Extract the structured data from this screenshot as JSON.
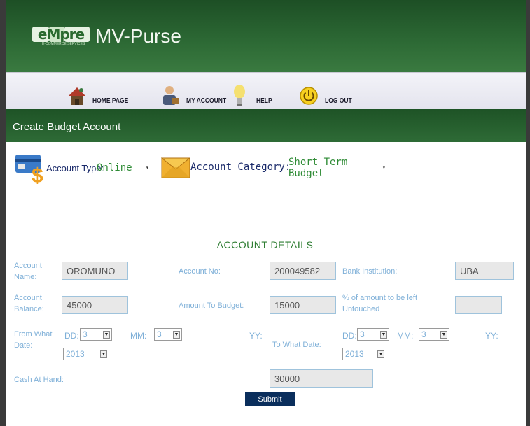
{
  "header": {
    "logo_text": "eMpre",
    "logo_sub": "E-COMMERCE SERVICES",
    "app_title": "MV-Purse"
  },
  "nav": {
    "items": [
      {
        "label": "HOME PAGE",
        "icon": "home-icon"
      },
      {
        "label": "MY ACCOUNT",
        "icon": "account-user-icon"
      },
      {
        "label": "HELP",
        "icon": "lightbulb-icon"
      },
      {
        "label": "LOG OUT",
        "icon": "power-icon"
      }
    ]
  },
  "section": {
    "title": "Create Budget Account"
  },
  "account_type": {
    "label": "Account Type:",
    "selected": "Online",
    "icon": "card-money-icon"
  },
  "account_category": {
    "label": "Account Category:",
    "selected": "Short Term Budget",
    "icon": "envelope-icon"
  },
  "details": {
    "title": "ACCOUNT DETAILS",
    "account_name_label": "Account Name:",
    "account_name_value": "OROMUNO",
    "account_no_label": "Account No:",
    "account_no_value": "200049582",
    "bank_label": "Bank Institution:",
    "bank_value": "UBA",
    "balance_label": "Account Balance:",
    "balance_value": "45000",
    "amount_budget_label": "Amount To Budget:",
    "amount_budget_value": "15000",
    "left_untouched_label": "% of amount to be left Untouched",
    "left_untouched_value": "",
    "from_date_label": "From What Date:",
    "to_date_label": "To What Date:",
    "dd_label": "DD:",
    "mm_label": "MM:",
    "yy_label": "YY:",
    "from_dd": "3",
    "from_mm": "3",
    "from_yy": "2013",
    "to_dd": "3",
    "to_mm": "3",
    "to_yy": "2013",
    "cash_label": "Cash At Hand:",
    "cash_value": "30000"
  },
  "submit_label": "Submit",
  "colors": {
    "header_green": "#2d6a35",
    "nav_bg": "#e8e8f0",
    "label_blue": "#7fb0d8",
    "submit_navy": "#0a2e5c",
    "select_green": "#2e8b35"
  }
}
